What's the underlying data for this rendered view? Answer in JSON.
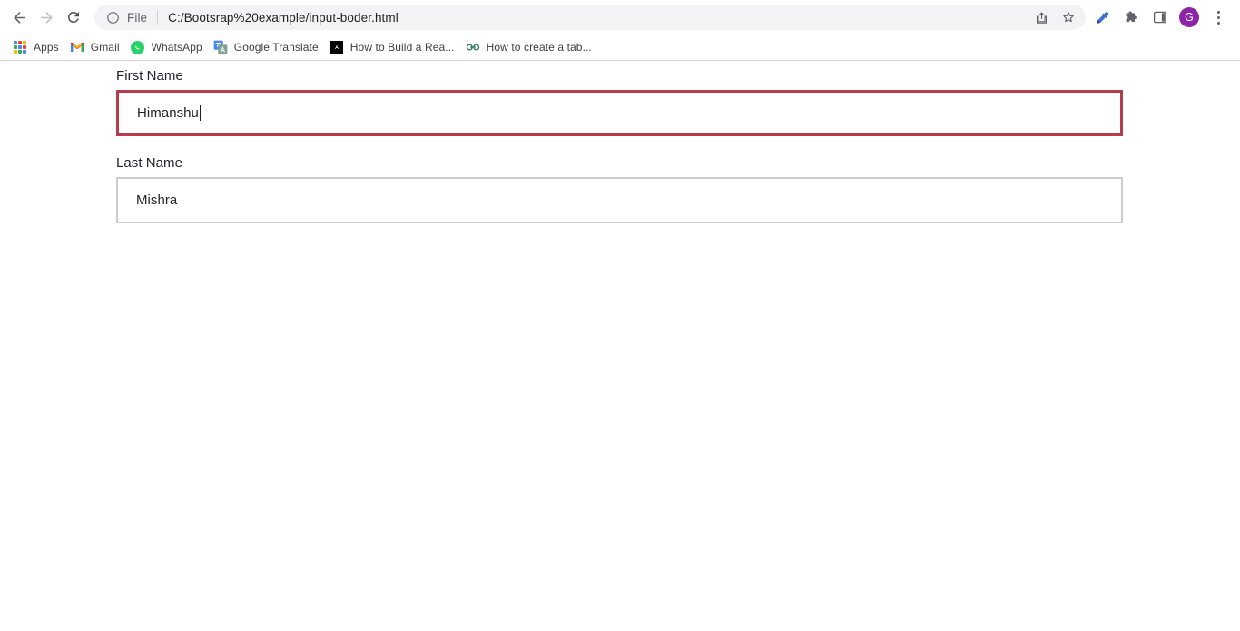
{
  "browser": {
    "nav": {
      "back_label": "Back",
      "forward_label": "Forward",
      "reload_label": "Reload"
    },
    "omnibox": {
      "info_icon": "info-circle-icon",
      "scheme_label": "File",
      "url": "C:/Bootsrap%20example/input-boder.html",
      "share_icon": "share-icon",
      "bookmark_icon": "star-icon"
    },
    "toolbar_right": [
      {
        "name": "eyedropper-icon",
        "label": "Color picker"
      },
      {
        "name": "extensions-icon",
        "label": "Extensions"
      },
      {
        "name": "side-panel-icon",
        "label": "Side panel"
      }
    ],
    "avatar": {
      "initial": "G",
      "color": "#8e24aa"
    },
    "menu_icon": "kebab-menu-icon",
    "bookmarks": [
      {
        "label": "Apps",
        "icon": "apps-grid-icon"
      },
      {
        "label": "Gmail",
        "icon": "gmail-icon"
      },
      {
        "label": "WhatsApp",
        "icon": "whatsapp-icon"
      },
      {
        "label": "Google Translate",
        "icon": "google-translate-icon"
      },
      {
        "label": "How to Build a Rea...",
        "icon": "angular-icon"
      },
      {
        "label": "How to create a tab...",
        "icon": "link-icon"
      }
    ]
  },
  "page": {
    "fields": [
      {
        "label": "First Name",
        "value": "Himanshu",
        "state": "danger",
        "border_color": "#b83b4b",
        "has_caret": true
      },
      {
        "label": "Last Name",
        "value": "Mishra",
        "state": "normal",
        "border_color": "#c9cdd1",
        "has_caret": false
      }
    ]
  }
}
